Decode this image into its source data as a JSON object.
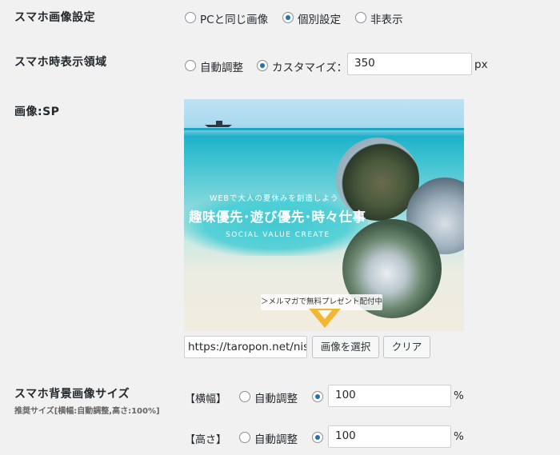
{
  "sp_image_setting": {
    "label": "スマホ画像設定",
    "options": [
      "PCと同じ画像",
      "個別設定",
      "非表示"
    ],
    "selected": "個別設定"
  },
  "sp_display_area": {
    "label": "スマホ時表示領域",
    "options": [
      "自動調整",
      "カスタマイズ："
    ],
    "selected": "カスタマイズ：",
    "value": "350",
    "unit": "px"
  },
  "sp_image": {
    "label": "画像:SP",
    "banner": {
      "small_text": "WEBで大人の夏休みを創造しよう",
      "main_text": "趣味優先･遊び優先･時々仕事",
      "english_text": "SOCIAL VALUE CREATE",
      "cta_text": "＞メルマガで無料プレゼント配付中＜"
    },
    "url_value": "https://taropon.net/nisl",
    "select_button": "画像を選択",
    "clear_button": "クリア"
  },
  "sp_bg_size": {
    "label": "スマホ背景画像サイズ",
    "recommend": "推奨サイズ[横幅:自動調整,高さ:100%]",
    "width": {
      "label": "【横幅】",
      "auto": "自動調整",
      "value": "100",
      "unit": "%"
    },
    "height": {
      "label": "【高さ】",
      "auto": "自動調整",
      "value": "100",
      "unit": "%"
    }
  }
}
